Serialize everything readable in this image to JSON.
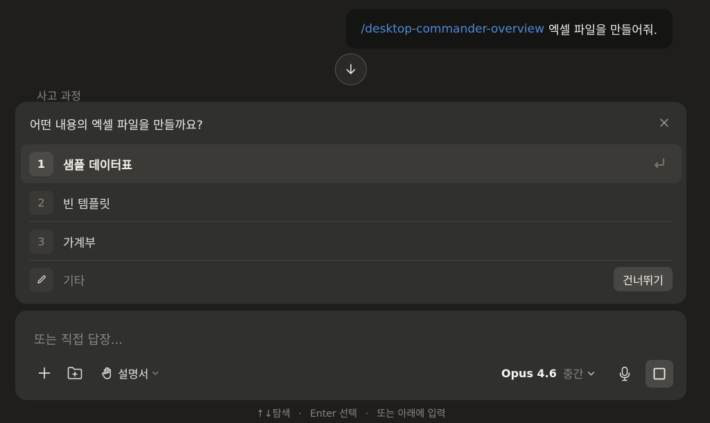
{
  "message": {
    "command": "/desktop-commander-overview",
    "text": "엑셀 파일을 만들어줘."
  },
  "thinking_label": "사고 과정",
  "question": {
    "title": "어떤 내용의 엑셀 파일을 만들까요?",
    "options": [
      {
        "num": "1",
        "label": "샘플 데이터표"
      },
      {
        "num": "2",
        "label": "빈 템플릿"
      },
      {
        "num": "3",
        "label": "가계부"
      }
    ],
    "other_label": "기타",
    "skip_label": "건너뛰기"
  },
  "composer": {
    "placeholder": "또는 직접 답장...",
    "style_label": "설명서",
    "model_label": "Opus 4.6",
    "effort_label": "중간"
  },
  "hint": {
    "navigate": "↑↓탐색",
    "select": "Enter 선택",
    "type_below": "또는 아래에 입력",
    "separator": "·"
  },
  "colors": {
    "background": "#1f1e1d",
    "panel": "#30302e",
    "accent_link": "#4f8ad6"
  }
}
